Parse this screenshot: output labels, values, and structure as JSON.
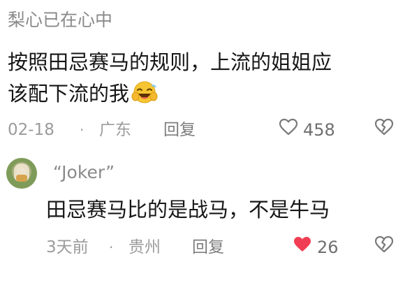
{
  "comment_1": {
    "username": "梨心已在心中",
    "text_line_1": "按照田忌赛马的规则，上流的姐姐应",
    "text_line_2": "该配下流的我",
    "emoji_icon": "laughing-emoji-icon",
    "date": "02-18",
    "separator": "·",
    "location": "广东",
    "reply_label": "回复",
    "like_count": "458"
  },
  "comment_2": {
    "username": "“Joker”",
    "text": "田忌赛马比的是战马，不是牛马",
    "date": "3天前",
    "separator": "·",
    "location": "贵州",
    "reply_label": "回复",
    "like_count": "26",
    "liked": true
  },
  "colors": {
    "liked_heart": "#f13d53",
    "meta_text": "#9b9b9b",
    "username_text": "#8a8a8a",
    "body_text": "#161616"
  },
  "icons": {
    "like": "heart-outline-icon",
    "liked": "heart-filled-icon",
    "dislike": "broken-heart-icon",
    "avatar": "user-avatar"
  }
}
